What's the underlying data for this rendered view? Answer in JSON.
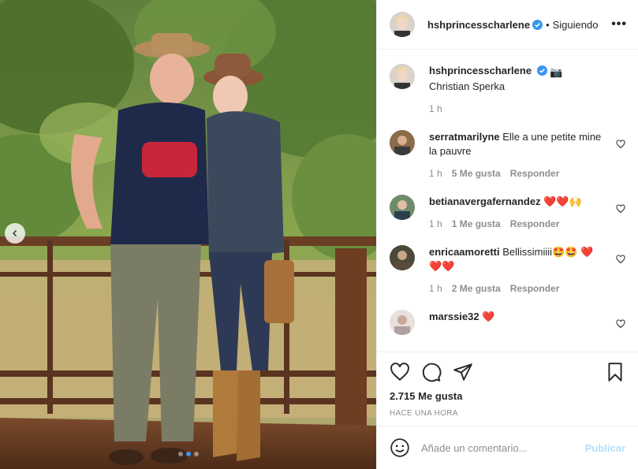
{
  "header": {
    "username": "hshprincesscharlene",
    "separator": "•",
    "follow_status": "Siguiendo",
    "more": "•••"
  },
  "caption": {
    "username": "hshprincesscharlene",
    "emoji": "📷",
    "text": "Christian Sperka",
    "time": "1 h"
  },
  "comments": [
    {
      "username": "serratmarilyne",
      "text": "Elle a une petite mine la pauvre",
      "time": "1 h",
      "likes": "5 Me gusta",
      "reply": "Responder"
    },
    {
      "username": "betianavergafernandez",
      "text": "❤️❤️🙌",
      "time": "1 h",
      "likes": "1 Me gusta",
      "reply": "Responder"
    },
    {
      "username": "enricaamoretti",
      "text": "Bellissimiiii🤩🤩 ❤️❤️❤️",
      "time": "1 h",
      "likes": "2 Me gusta",
      "reply": "Responder"
    },
    {
      "username": "marssie32",
      "text": "❤️",
      "time": "",
      "likes": "",
      "reply": ""
    }
  ],
  "post": {
    "likes_count": "2.715 Me gusta",
    "time_ago": "HACE UNA HORA"
  },
  "composer": {
    "placeholder": "Añade un comentario...",
    "publish_label": "Publicar"
  },
  "carousel": {
    "current": 1,
    "total": 3
  },
  "icons": {
    "prev": "chevron-left-icon",
    "like": "heart-icon",
    "comment": "comment-icon",
    "share": "paper-plane-icon",
    "save": "bookmark-icon",
    "emoji": "smiley-icon",
    "verified": "verified-badge-icon"
  },
  "colors": {
    "verified": "#3897f0",
    "publish_disabled": "#b2dffc",
    "meta_text": "#8e8e8e",
    "heart_red": "#ed4956"
  }
}
